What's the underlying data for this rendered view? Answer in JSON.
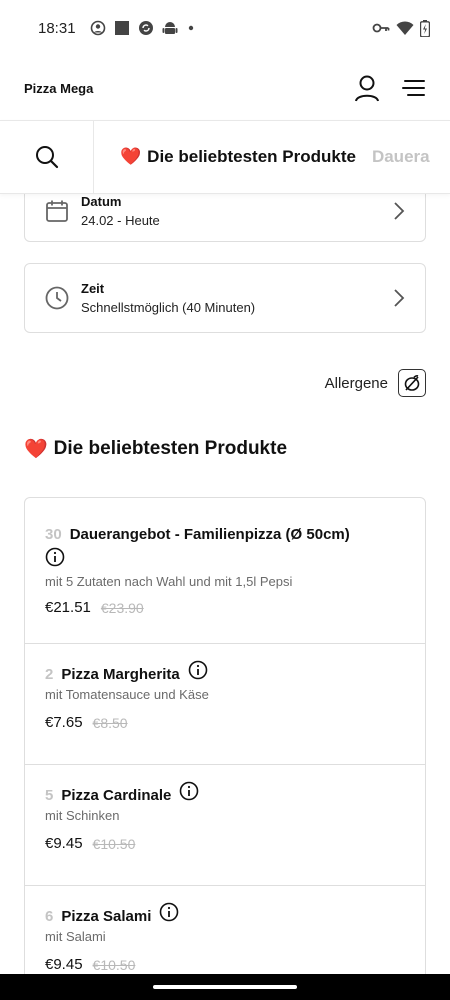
{
  "status_bar": {
    "time": "18:31",
    "left_icons": [
      "user-circle-icon",
      "stop-square-icon",
      "sync-circle-icon",
      "android-icon",
      "dot-icon"
    ],
    "right_icons": [
      "key-icon",
      "wifi-icon",
      "battery-charging-icon"
    ]
  },
  "header": {
    "brand": "Pizza Mega",
    "actions": [
      "account-icon",
      "menu-icon"
    ]
  },
  "tabs": {
    "search_icon": "search-icon",
    "items": [
      {
        "emoji": "❤️",
        "label": "Die beliebtesten Produkte",
        "active": true
      },
      {
        "label": "Dauera",
        "active": false
      }
    ]
  },
  "date_card": {
    "icon": "calendar-icon",
    "title": "Datum",
    "value": "24.02 - Heute"
  },
  "time_card": {
    "icon": "clock-icon",
    "title": "Zeit",
    "value": "Schnellstmöglich (40 Minuten)"
  },
  "allergens": {
    "label": "Allergene",
    "icon": "allergen-filter-icon"
  },
  "section": {
    "emoji": "❤️",
    "title": "Die beliebtesten Produkte"
  },
  "products": [
    {
      "number": "30",
      "name": "Dauerangebot - Familienpizza (Ø 50cm)",
      "description": "mit 5 Zutaten nach Wahl und mit 1,5l Pepsi",
      "price": "€21.51",
      "old_price": "€23.90"
    },
    {
      "number": "2",
      "name": "Pizza Margherita",
      "description": "mit Tomatensauce und Käse",
      "price": "€7.65",
      "old_price": "€8.50"
    },
    {
      "number": "5",
      "name": "Pizza Cardinale",
      "description": "mit Schinken",
      "price": "€9.45",
      "old_price": "€10.50"
    },
    {
      "number": "6",
      "name": "Pizza Salami",
      "description": "mit Salami",
      "price": "€9.45",
      "old_price": "€10.50"
    }
  ],
  "colors": {
    "accent_heart": "#e53935",
    "muted": "#c4c4c4",
    "border": "#dedede"
  }
}
